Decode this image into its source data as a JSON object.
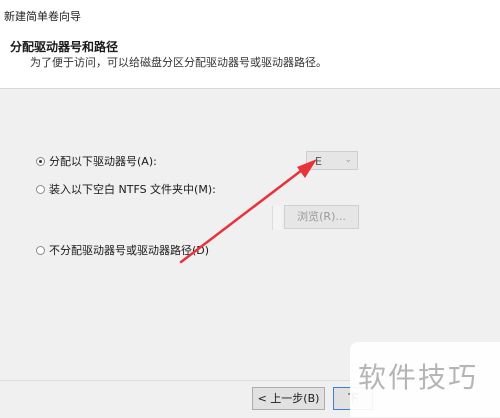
{
  "window": {
    "title": "新建简单卷向导"
  },
  "header": {
    "title": "分配驱动器号和路径",
    "subtitle": "为了便于访问，可以给磁盘分区分配驱动器号或驱动器路径。"
  },
  "options": [
    {
      "label": "分配以下驱动器号(A):",
      "checked": true
    },
    {
      "label": "装入以下空白 NTFS 文件夹中(M):",
      "checked": false
    },
    {
      "label": "不分配驱动器号或驱动器路径(D)",
      "checked": false
    }
  ],
  "drive_letter": {
    "value": "E"
  },
  "browse_button": {
    "label": "浏览(R)..."
  },
  "footer": {
    "back_label": "< 上一步(B)",
    "next_label": "下"
  },
  "watermark": {
    "text": "软件技巧"
  },
  "colors": {
    "annotation_arrow": "#e8323c",
    "primary_button_border": "#3c7fd6"
  }
}
